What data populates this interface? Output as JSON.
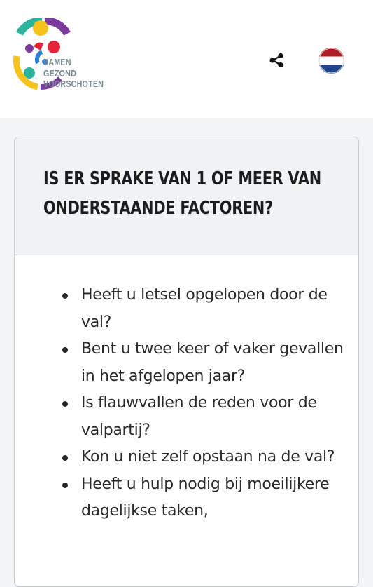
{
  "header": {
    "logo_lines": [
      "SAMEN",
      "GEZOND",
      "VOORSCHOTEN"
    ],
    "share_icon": "share-icon",
    "language_icon": "netherlands-flag-icon"
  },
  "colors": {
    "teal": "#2bb39b",
    "yellow": "#f6c21c",
    "purple": "#7b3a9c",
    "red": "#e5243b",
    "blue": "#2b7fd1",
    "flag_red": "#ae1c28",
    "flag_blue": "#21468b"
  },
  "card": {
    "title": "Is er sprake van 1 of meer van onderstaande factoren?",
    "items": [
      "Heeft u letsel opgelopen door de val?",
      "Bent u twee keer of vaker gevallen in het afgelopen jaar?",
      "Is flauwvallen de reden voor de valpartij?",
      "Kon u niet zelf opstaan na de val?",
      "Heeft u hulp nodig bij moeilijkere dagelijkse taken,"
    ]
  }
}
